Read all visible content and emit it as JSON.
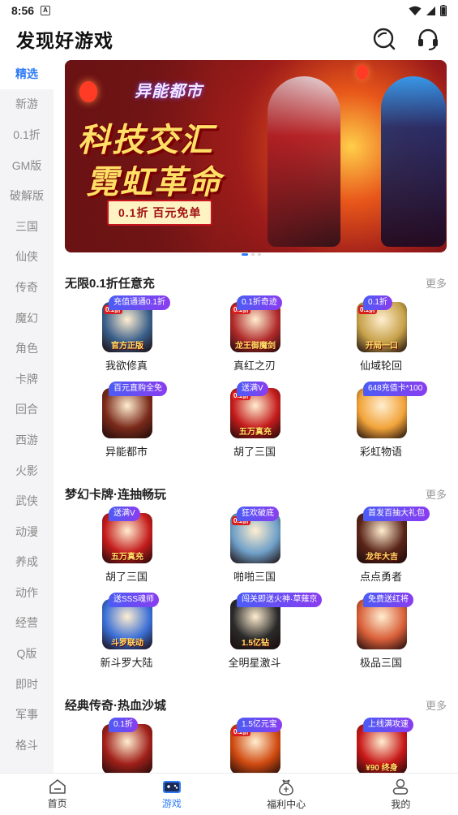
{
  "status_bar": {
    "time": "8:56",
    "notif": "A"
  },
  "header": {
    "title": "发现好游戏"
  },
  "sidebar": {
    "categories": [
      "精选",
      "新游",
      "0.1折",
      "GM版",
      "破解版",
      "三国",
      "仙侠",
      "传奇",
      "魔幻",
      "角色",
      "卡牌",
      "回合",
      "西游",
      "火影",
      "武侠",
      "动漫",
      "养成",
      "动作",
      "经营",
      "Q版",
      "即时",
      "军事",
      "格斗"
    ]
  },
  "banner": {
    "logo": "异能都市",
    "headline1": "科技交汇",
    "headline2": "霓虹革命",
    "tagline": "0.1折 百元免单"
  },
  "sections": [
    {
      "title": "无限0.1折任意充",
      "more": "更多",
      "games": [
        {
          "name": "我欲修真",
          "tag": "充值通通0.1折",
          "caption": "官方正版",
          "discount": "0.1折",
          "color": "#3a5f8a"
        },
        {
          "name": "真红之刃",
          "tag": "0.1折奇迹",
          "caption": "龙王御魔剑",
          "discount": "0.1折",
          "color": "#b02a2a"
        },
        {
          "name": "仙域轮回",
          "tag": "0.1折",
          "caption": "开局一口",
          "discount": "0.1折",
          "color": "#c7a24a"
        },
        {
          "name": "异能都市",
          "tag": "百元直购全免",
          "caption": "",
          "discount": "",
          "color": "#7a2a1a"
        },
        {
          "name": "胡了三国",
          "tag": "送满V",
          "caption": "五万真充",
          "discount": "0.1折",
          "color": "#c41c1c"
        },
        {
          "name": "彩虹物语",
          "tag": "648充值卡*100",
          "caption": "",
          "discount": "",
          "color": "#f2a43a"
        }
      ]
    },
    {
      "title": "梦幻卡牌·连抽畅玩",
      "more": "更多",
      "games": [
        {
          "name": "胡了三国",
          "tag": "送满V",
          "caption": "五万真充",
          "discount": "",
          "color": "#c41c1c"
        },
        {
          "name": "啪啪三国",
          "tag": "狂欢破底",
          "caption": "",
          "discount": "0.1折",
          "color": "#6fa0c8"
        },
        {
          "name": "点点勇者",
          "tag": "首发百抽大礼包",
          "caption": "龙年大吉",
          "discount": "",
          "color": "#5a2418"
        },
        {
          "name": "新斗罗大陆",
          "tag": "送SSS魂师",
          "caption": "斗罗联动",
          "discount": "",
          "color": "#3b6fd6"
        },
        {
          "name": "全明星激斗",
          "tag": "闯关即送火神·草薙京",
          "caption": "1.5亿钻",
          "discount": "",
          "color": "#2a2a2a"
        },
        {
          "name": "极品三国",
          "tag": "免费送红将",
          "caption": "",
          "discount": "",
          "color": "#d9603a"
        }
      ]
    },
    {
      "title": "经典传奇·热血沙城",
      "more": "更多",
      "games": [
        {
          "name": "",
          "tag": "0.1折",
          "caption": "",
          "discount": "",
          "color": "#a0201a"
        },
        {
          "name": "",
          "tag": "1.5亿元宝",
          "caption": "",
          "discount": "0.1折",
          "color": "#d04a10"
        },
        {
          "name": "",
          "tag": "上线满攻速",
          "caption": "¥90 终身",
          "discount": "",
          "color": "#c81818"
        }
      ]
    }
  ],
  "bottom_nav": [
    {
      "label": "首页",
      "icon": "home-icon"
    },
    {
      "label": "游戏",
      "icon": "gamepad-icon"
    },
    {
      "label": "福利中心",
      "icon": "gift-bag-icon"
    },
    {
      "label": "我的",
      "icon": "profile-icon"
    }
  ],
  "colors": {
    "accent": "#2e7bf6",
    "tag_gradient_start": "#4b5cf5",
    "tag_gradient_end": "#8a3df0"
  }
}
